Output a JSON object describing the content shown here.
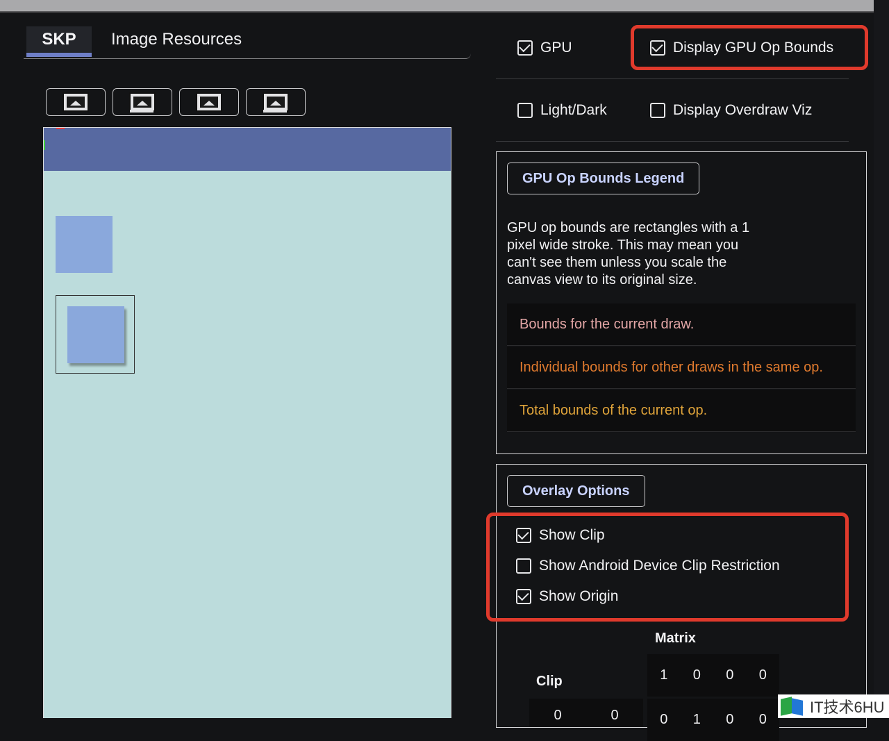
{
  "tabs": {
    "skp": "SKP",
    "image_resources": "Image Resources"
  },
  "canvas_buttons": [
    {
      "icon": "image-fit-icon"
    },
    {
      "icon": "image-actual-size-icon"
    },
    {
      "icon": "image-scrollbar-icon"
    },
    {
      "icon": "image-bottom-bar-icon"
    }
  ],
  "options": {
    "gpu": {
      "label": "GPU",
      "checked": true
    },
    "display_gpu_op_bounds": {
      "label": "Display GPU Op Bounds",
      "checked": true
    },
    "light_dark": {
      "label": "Light/Dark",
      "checked": false
    },
    "display_overdraw_viz": {
      "label": "Display Overdraw Viz",
      "checked": false
    }
  },
  "legend": {
    "title": "GPU Op Bounds Legend",
    "description": "GPU op bounds are rectangles with a 1 pixel wide stroke. This may mean you can't see them unless you scale the canvas view to its original size.",
    "items": [
      {
        "text": "Bounds for the current draw.",
        "color": "#e3a6a6"
      },
      {
        "text": "Individual bounds for other draws in the same op.",
        "color": "#e07a2e"
      },
      {
        "text": "Total bounds of the current op.",
        "color": "#e0a43a"
      }
    ]
  },
  "overlay": {
    "title": "Overlay Options",
    "show_clip": {
      "label": "Show Clip",
      "checked": true
    },
    "show_android_clip": {
      "label": "Show Android Device Clip Restriction",
      "checked": false
    },
    "show_origin": {
      "label": "Show Origin",
      "checked": true
    }
  },
  "matrix": {
    "label": "Matrix",
    "row1": [
      "1",
      "0",
      "0",
      "0"
    ],
    "row2": [
      "0",
      "1",
      "0",
      "0"
    ]
  },
  "clip": {
    "label": "Clip",
    "row1": [
      "0",
      "0"
    ]
  },
  "watermark": {
    "text": "IT技术6HU"
  },
  "highlight_color": "#e03a2c"
}
